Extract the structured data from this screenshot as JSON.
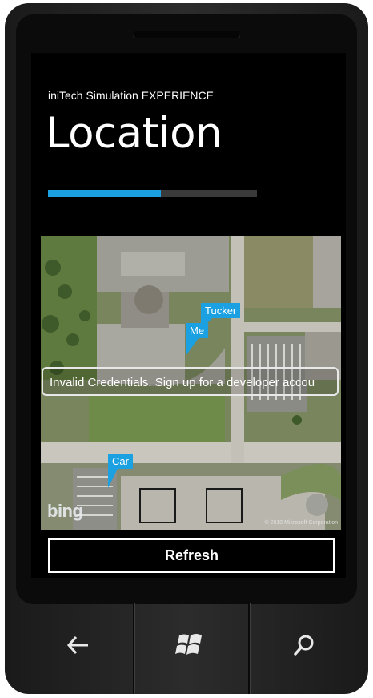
{
  "app": {
    "title": "iniTech Simulation EXPERIENCE",
    "page_title": "Location"
  },
  "progress": {
    "value_fraction": 0.54,
    "fill_color": "#1ba1e2",
    "track_color": "#3a3a3a"
  },
  "map": {
    "pins": [
      {
        "label": "Tucker"
      },
      {
        "label": "Me"
      },
      {
        "label": "Car"
      }
    ],
    "error_message": "Invalid Credentials. Sign up for a developer accou",
    "logo": "bing",
    "copyright": "© 2010 Microsoft Corporation"
  },
  "actions": {
    "refresh_label": "Refresh"
  },
  "hardware": {
    "back_icon": "back-arrow-icon",
    "start_icon": "windows-logo-icon",
    "search_icon": "search-icon"
  },
  "colors": {
    "accent": "#1ba1e2",
    "background": "#000000",
    "text": "#ffffff"
  }
}
